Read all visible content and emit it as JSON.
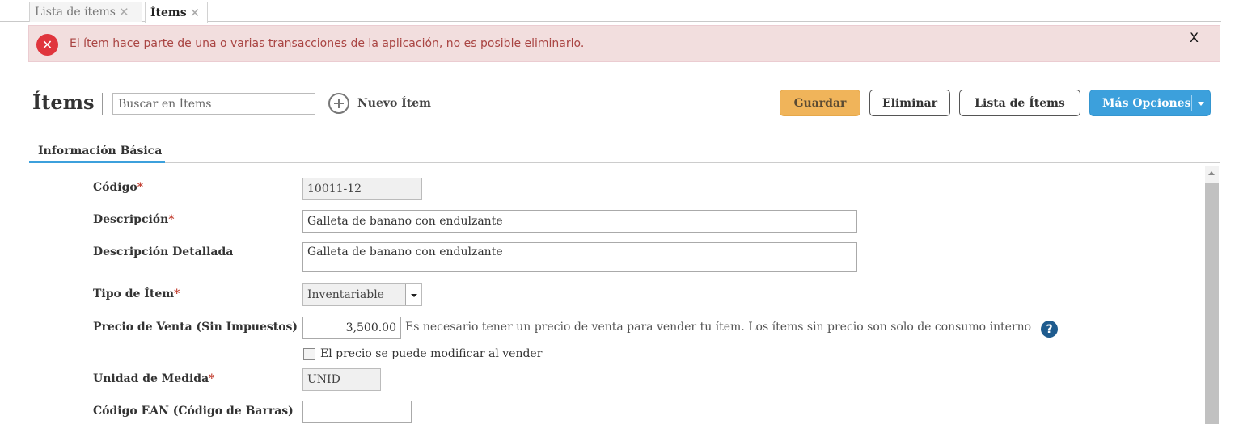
{
  "tabs": [
    {
      "label": "Lista de ítems",
      "close": "✕"
    },
    {
      "label": "Ítems",
      "close": "✕"
    }
  ],
  "alert": {
    "icon": "error-x-icon",
    "message": "El ítem hace parte de una o varias transacciones de la aplicación, no es posible eliminarlo.",
    "close": "X"
  },
  "header": {
    "title": "Ítems",
    "search_placeholder": "Buscar en Ítems",
    "new_item": "Nuevo Ítem"
  },
  "toolbar": {
    "save": "Guardar",
    "delete": "Eliminar",
    "list": "Lista de Ítems",
    "more": "Más Opciones"
  },
  "section": {
    "tab": "Información Básica"
  },
  "form": {
    "codigo": {
      "label": "Código",
      "required": "*",
      "value": "10011-12"
    },
    "descripcion": {
      "label": "Descripción",
      "required": "*",
      "value": "Galleta de banano con endulzante"
    },
    "descripcion_detallada": {
      "label": "Descripción Detallada",
      "value": "Galleta de banano con endulzante"
    },
    "tipo_item": {
      "label": "Tipo de Ítem",
      "required": "*",
      "value": "Inventariable"
    },
    "precio_venta": {
      "label": "Precio de Venta (Sin Impuestos)",
      "value": "3,500.00",
      "note": "Es necesario tener un precio de venta para vender tu ítem. Los ítems sin precio son solo de consumo interno",
      "help": "?"
    },
    "precio_modificable": {
      "label": "El precio se puede modificar al vender",
      "checked": false
    },
    "unidad_medida": {
      "label": "Unidad de Medida",
      "required": "*",
      "value": "UNID"
    },
    "codigo_ean": {
      "label": "Código EAN (Código de Barras)",
      "value": ""
    }
  },
  "colors": {
    "accent": "#3ca0dc",
    "save": "#f0b45a",
    "alert_bg": "#f2dede",
    "alert_text": "#a94442",
    "error_icon": "#e0353d"
  }
}
